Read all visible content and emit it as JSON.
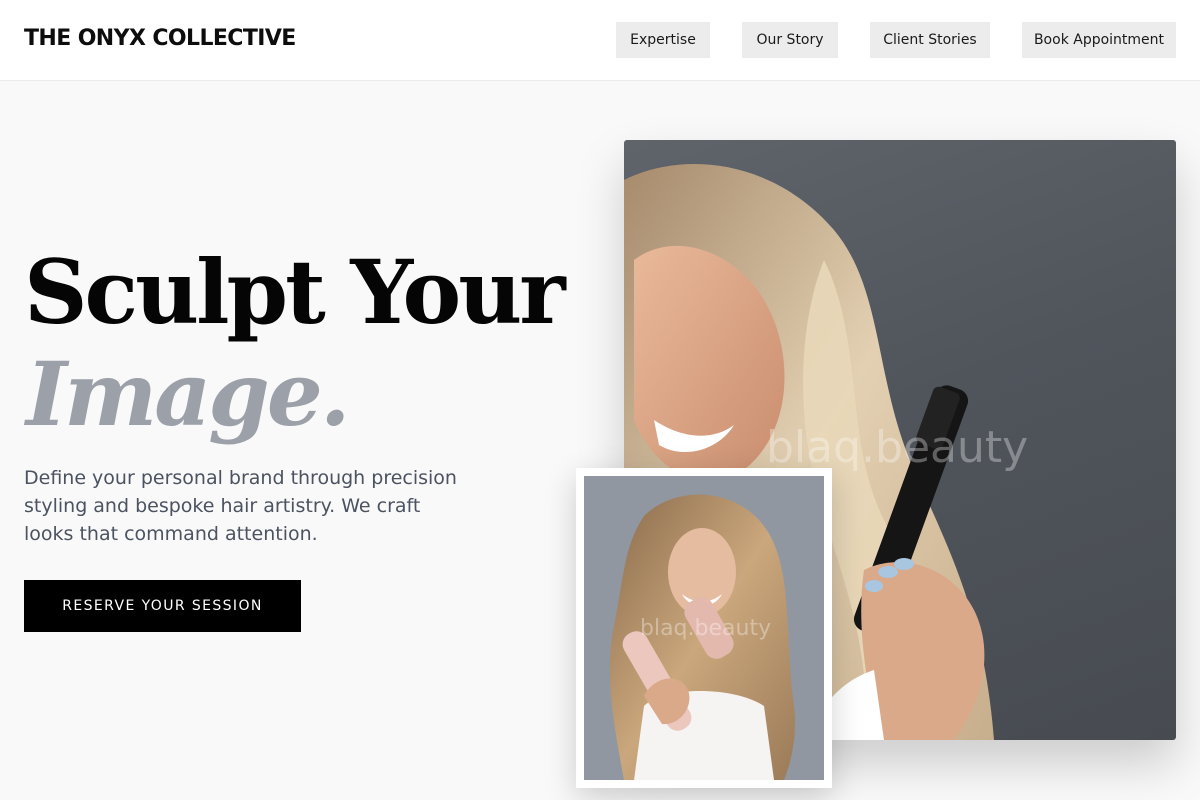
{
  "header": {
    "brand": "THE ONYX COLLECTIVE",
    "nav": {
      "expertise": "Expertise",
      "our_story": "Our Story",
      "client_stories": "Client Stories",
      "book": "Book Appointment"
    }
  },
  "hero": {
    "headline_line1": "Sculpt Your",
    "headline_line2": "Image.",
    "description": "Define your personal brand through precision styling and bespoke hair artistry. We craft looks that command attention.",
    "cta_label": "RESERVE YOUR SESSION"
  },
  "images": {
    "main_watermark": "blaq.beauty",
    "inset_watermark": "blaq.beauty"
  },
  "colors": {
    "accent_text": "#9ba0a9",
    "cta_background": "#000000",
    "nav_background": "#ececec"
  }
}
